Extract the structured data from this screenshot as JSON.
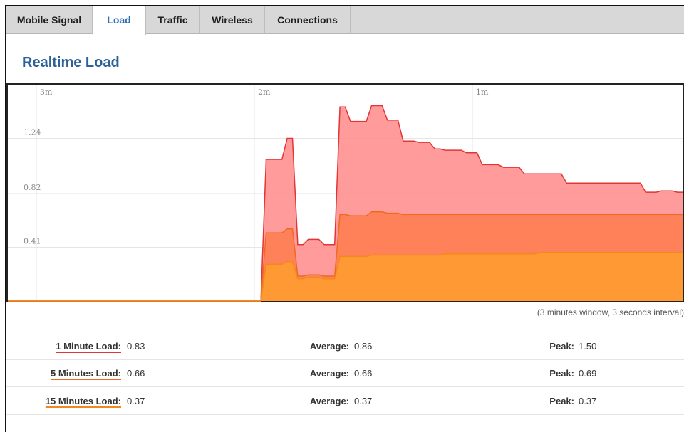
{
  "tabs": [
    {
      "label": "Mobile Signal",
      "active": false
    },
    {
      "label": "Load",
      "active": true
    },
    {
      "label": "Traffic",
      "active": false
    },
    {
      "label": "Wireless",
      "active": false
    },
    {
      "label": "Connections",
      "active": false
    }
  ],
  "page_title": "Realtime Load",
  "window_note": "(3 minutes window, 3 seconds interval)",
  "chart_data": {
    "type": "area",
    "x_ticks": [
      "3m",
      "2m",
      "1m"
    ],
    "y_ticks": [
      "1.24",
      "0.82",
      "0.41"
    ],
    "ylim": [
      0,
      1.65
    ],
    "grid": true,
    "colors": {
      "1min": "#ff8a8a",
      "5min": "#ff7a4a",
      "15min": "#ff9a33",
      "line1": "#e23535",
      "line5": "#ee6a1e",
      "line15": "#f08a1c"
    },
    "series": [
      {
        "key": "1min",
        "values": [
          0,
          0,
          0,
          0,
          0,
          0,
          0,
          0,
          0,
          0,
          0,
          0,
          0,
          0,
          0,
          0,
          0,
          0,
          0,
          0,
          0,
          0,
          0,
          0,
          0,
          0,
          0,
          0,
          0,
          0,
          0,
          0,
          0,
          0,
          0,
          0,
          0,
          0,
          0,
          0,
          0,
          0,
          0,
          0,
          0,
          0,
          0,
          0,
          0,
          1.08,
          1.08,
          1.08,
          1.08,
          1.24,
          1.24,
          0.43,
          0.43,
          0.47,
          0.47,
          0.47,
          0.43,
          0.43,
          0.43,
          1.48,
          1.48,
          1.37,
          1.37,
          1.37,
          1.37,
          1.49,
          1.49,
          1.49,
          1.38,
          1.38,
          1.38,
          1.22,
          1.22,
          1.22,
          1.21,
          1.21,
          1.21,
          1.16,
          1.16,
          1.15,
          1.15,
          1.15,
          1.15,
          1.13,
          1.13,
          1.13,
          1.04,
          1.04,
          1.04,
          1.04,
          1.02,
          1.02,
          1.02,
          1.02,
          0.97,
          0.97,
          0.97,
          0.97,
          0.97,
          0.97,
          0.97,
          0.97,
          0.9,
          0.9,
          0.9,
          0.9,
          0.9,
          0.9,
          0.9,
          0.9,
          0.9,
          0.9,
          0.9,
          0.9,
          0.9,
          0.9,
          0.9,
          0.83,
          0.83,
          0.83,
          0.84,
          0.84,
          0.84,
          0.83,
          0.83
        ]
      },
      {
        "key": "5min",
        "values": [
          0,
          0,
          0,
          0,
          0,
          0,
          0,
          0,
          0,
          0,
          0,
          0,
          0,
          0,
          0,
          0,
          0,
          0,
          0,
          0,
          0,
          0,
          0,
          0,
          0,
          0,
          0,
          0,
          0,
          0,
          0,
          0,
          0,
          0,
          0,
          0,
          0,
          0,
          0,
          0,
          0,
          0,
          0,
          0,
          0,
          0,
          0,
          0,
          0,
          0.52,
          0.52,
          0.52,
          0.52,
          0.55,
          0.55,
          0.19,
          0.19,
          0.2,
          0.2,
          0.2,
          0.19,
          0.19,
          0.19,
          0.66,
          0.66,
          0.65,
          0.65,
          0.65,
          0.65,
          0.68,
          0.68,
          0.68,
          0.67,
          0.67,
          0.67,
          0.66,
          0.66,
          0.66,
          0.66,
          0.66,
          0.66,
          0.66,
          0.66,
          0.66,
          0.66,
          0.66,
          0.66,
          0.66,
          0.66,
          0.66,
          0.66,
          0.66,
          0.66,
          0.66,
          0.66,
          0.66,
          0.66,
          0.66,
          0.66,
          0.66,
          0.66,
          0.66,
          0.66,
          0.66,
          0.66,
          0.66,
          0.66,
          0.66,
          0.66,
          0.66,
          0.66,
          0.66,
          0.66,
          0.66,
          0.66,
          0.66,
          0.66,
          0.66,
          0.66,
          0.66,
          0.66,
          0.66,
          0.66,
          0.66,
          0.66,
          0.66,
          0.66,
          0.66,
          0.66
        ]
      },
      {
        "key": "15min",
        "values": [
          0,
          0,
          0,
          0,
          0,
          0,
          0,
          0,
          0,
          0,
          0,
          0,
          0,
          0,
          0,
          0,
          0,
          0,
          0,
          0,
          0,
          0,
          0,
          0,
          0,
          0,
          0,
          0,
          0,
          0,
          0,
          0,
          0,
          0,
          0,
          0,
          0,
          0,
          0,
          0,
          0,
          0,
          0,
          0,
          0,
          0,
          0,
          0,
          0,
          0.28,
          0.28,
          0.28,
          0.28,
          0.3,
          0.3,
          0.17,
          0.17,
          0.18,
          0.18,
          0.18,
          0.17,
          0.17,
          0.17,
          0.34,
          0.34,
          0.34,
          0.34,
          0.34,
          0.34,
          0.35,
          0.35,
          0.35,
          0.35,
          0.35,
          0.35,
          0.35,
          0.35,
          0.35,
          0.35,
          0.35,
          0.35,
          0.35,
          0.35,
          0.36,
          0.36,
          0.36,
          0.36,
          0.36,
          0.36,
          0.36,
          0.36,
          0.36,
          0.36,
          0.36,
          0.36,
          0.36,
          0.36,
          0.36,
          0.36,
          0.36,
          0.36,
          0.37,
          0.37,
          0.37,
          0.37,
          0.37,
          0.37,
          0.37,
          0.37,
          0.37,
          0.37,
          0.37,
          0.37,
          0.37,
          0.37,
          0.37,
          0.37,
          0.37,
          0.37,
          0.37,
          0.37,
          0.37,
          0.37,
          0.37,
          0.37,
          0.37,
          0.37,
          0.37,
          0.37
        ]
      }
    ]
  },
  "stats": [
    {
      "label": "1 Minute Load:",
      "value": "0.83",
      "avg_label": "Average:",
      "avg": "0.86",
      "peak_label": "Peak:",
      "peak": "1.50",
      "color": "#e23535"
    },
    {
      "label": "5 Minutes Load:",
      "value": "0.66",
      "avg_label": "Average:",
      "avg": "0.66",
      "peak_label": "Peak:",
      "peak": "0.69",
      "color": "#ee6a1e"
    },
    {
      "label": "15 Minutes Load:",
      "value": "0.37",
      "avg_label": "Average:",
      "avg": "0.37",
      "peak_label": "Peak:",
      "peak": "0.37",
      "color": "#f08a1c"
    }
  ]
}
